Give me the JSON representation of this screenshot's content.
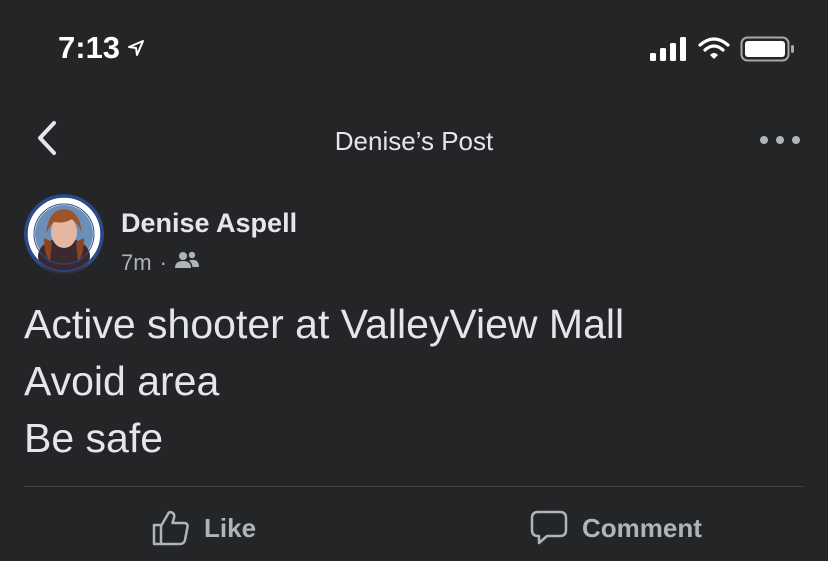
{
  "status_bar": {
    "time": "7:13",
    "icons": [
      "location-arrow-icon",
      "cellular-signal-icon",
      "wifi-icon",
      "battery-icon"
    ]
  },
  "header": {
    "title": "Denise’s Post",
    "back_icon": "chevron-left-icon",
    "more_icon": "more-horizontal-icon"
  },
  "post": {
    "author": "Denise Aspell",
    "time_ago": "7m",
    "separator": "·",
    "audience_icon": "friends-icon",
    "body_lines": [
      "Active shooter at ValleyView Mall",
      "Avoid area",
      "Be safe"
    ]
  },
  "actions": {
    "like_label": "Like",
    "comment_label": "Comment"
  },
  "colors": {
    "background": "#242527",
    "primary_text": "#e4e6eb",
    "secondary_text": "#b0b3b8",
    "divider": "#3e4042"
  }
}
